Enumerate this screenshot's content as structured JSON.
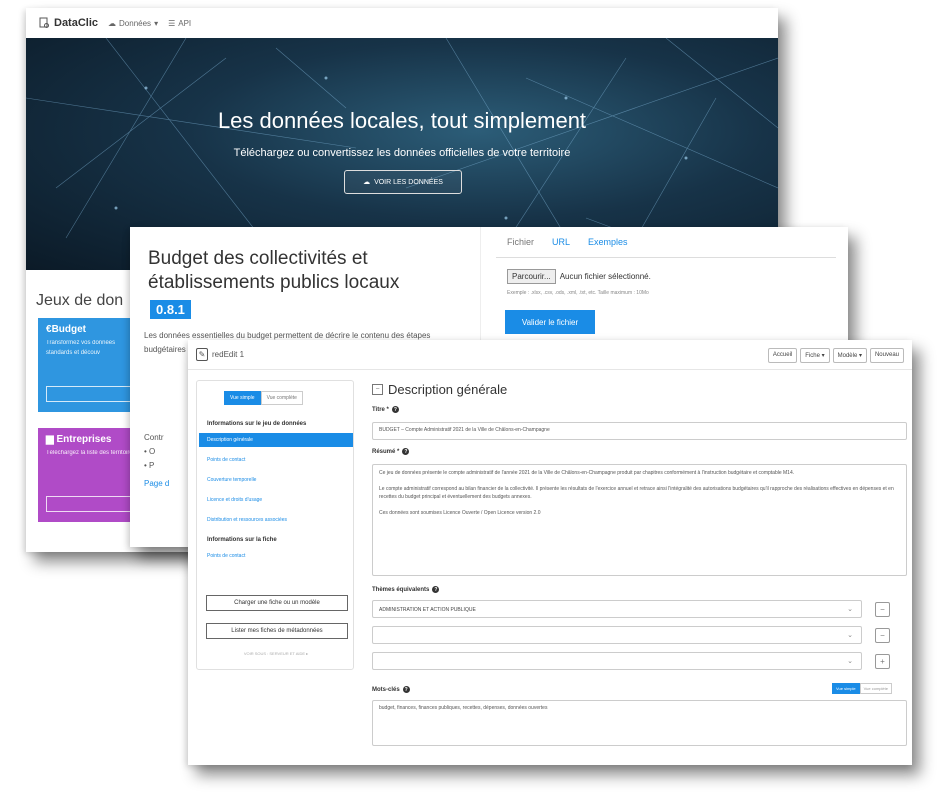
{
  "window1": {
    "brand": "DataClic",
    "nav": [
      {
        "label": "Données",
        "icon": "cloud-icon",
        "has_caret": true
      },
      {
        "label": "API",
        "icon": "list-icon",
        "has_caret": false
      }
    ],
    "hero_title": "Les données locales, tout simplement",
    "hero_subtitle": "Téléchargez ou convertissez les données officielles de votre territoire",
    "hero_button": "VOIR LES DONNÉES",
    "section_title": "Jeux de don",
    "categories": [
      {
        "title": "Budget",
        "desc": "Transformez vos données standards et découv"
      },
      {
        "title": "Entreprises",
        "desc": "Téléchargez la liste des territoire"
      }
    ]
  },
  "window2": {
    "title": "Budget des collectivités et établissements publics locaux",
    "version": "0.8.1",
    "description": "Les données essentielles du budget permettent de décrire le contenu des étapes budgétaires ... publics ... ainsi que ... présente ... détaillé ... associé ...",
    "desc_tail": "Contr",
    "desc_bullets": [
      "O",
      "P"
    ],
    "page_link": "Page d",
    "tabs": [
      {
        "label": "Fichier",
        "link": false
      },
      {
        "label": "URL",
        "link": true
      },
      {
        "label": "Exemples",
        "link": true
      }
    ],
    "browse_label": "Parcourir...",
    "no_file": "Aucun fichier sélectionné.",
    "file_hint": "Exemple : .xlsx, .csv, .ods, .xml, .txt, etc. Taille maximum : 10Mo",
    "validate_label": "Valider le fichier"
  },
  "window3": {
    "app_name": "redEdit 1",
    "top_buttons": [
      "Accueil",
      "Fiche ▾",
      "Modèle ▾",
      "Nouveau"
    ],
    "toggle": {
      "on": "Vue simple",
      "off": "Vue complète"
    },
    "group1": "Informations sur le jeu de données",
    "items1": [
      {
        "label": "Description générale",
        "active": true
      },
      {
        "label": "Points de contact",
        "active": false
      },
      {
        "label": "Couverture temporelle",
        "active": false
      },
      {
        "label": "Licence et droits d'usage",
        "active": false
      },
      {
        "label": "Distribution et ressources associées",
        "active": false
      }
    ],
    "group2": "Informations sur la fiche",
    "items2": [
      {
        "label": "Points de contact",
        "active": false
      }
    ],
    "side_buttons": [
      "Charger une fiche ou un modèle",
      "Lister mes fiches de métadonnées"
    ],
    "side_footer": "VOIR SOUS : SERVEUR ET AIDE ▸",
    "section_title": "Description générale",
    "titre_label": "Titre *",
    "titre_value": "BUDGET – Compte Administratif 2021 de la Ville de Châlons-en-Champagne",
    "resume_label": "Résumé *",
    "resume_paragraphs": [
      "Ce jeu de données présente le compte administratif de l'année 2021 de la Ville de Châlons-en-Champagne produit par chapitres conformément à l'instruction budgétaire et comptable M14.",
      "Le compte administratif correspond au bilan financier de la collectivité. Il présente les résultats de l'exercice annuel et retrace ainsi l'intégralité des autorisations budgétaires qu'il rapproche des réalisations effectives en dépenses et en recettes du budget principal et éventuellement des budgets annexes.",
      "Ces données sont soumises Licence Ouverte / Open Licence version 2.0"
    ],
    "themes_label": "Thèmes équivalents",
    "themes": [
      "ADMINISTRATION ET ACTION PUBLIQUE",
      "",
      ""
    ],
    "themes_buttons": [
      "−",
      "−",
      "+"
    ],
    "kw_label": "Mots-clés",
    "kw_toggle": {
      "on": "Vue simple",
      "off": "Vue complète"
    },
    "kw_value": "budget, finances, finances publiques, recettes, dépenses, données ouvertes"
  },
  "colors": {
    "accent": "#1a8ce6",
    "budget": "#2f96e0",
    "entreprises": "#b04bc7",
    "hero_dark": "#0b1a27"
  }
}
